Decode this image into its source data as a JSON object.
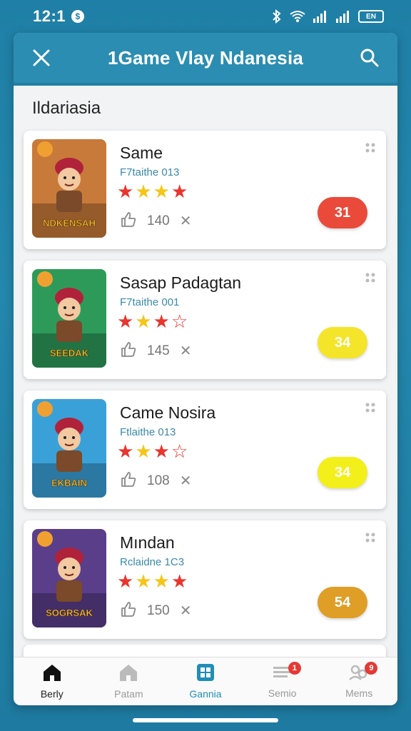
{
  "status_bar": {
    "time": "12:1",
    "notif_glyph": "$",
    "battery": "EN"
  },
  "header": {
    "title": "1Game Vlay Ndanesia",
    "close_icon": "close-icon",
    "search_icon": "search-icon"
  },
  "section": {
    "title": "Ildariasia"
  },
  "games": [
    {
      "name": "Same",
      "subtitle": "F7taithe 013",
      "rating": 4,
      "likes": "140",
      "badge": "31",
      "badge_color": "#e94a3a",
      "thumb_text": "NDKENSAH",
      "thumb_bg": "#c87a3a"
    },
    {
      "name": "Sasap Padagtan",
      "subtitle": "F7taithe 001",
      "rating": 3,
      "likes": "145",
      "badge": "34",
      "badge_color": "#f4e52a",
      "thumb_text": "SEEDAK",
      "thumb_bg": "#2e9a5a"
    },
    {
      "name": "Came Nosira",
      "subtitle": "Ftlaithe 013",
      "rating": 3,
      "likes": "108",
      "badge": "34",
      "badge_color": "#f3ef1a",
      "thumb_text": "EKBAIN",
      "thumb_bg": "#3aa0d8"
    },
    {
      "name": "Mından",
      "subtitle": "Rclaidne 1C3",
      "rating": 4,
      "likes": "150",
      "badge": "54",
      "badge_color": "#df9e26",
      "thumb_text": "SOGRSAK",
      "thumb_bg": "#5a3e8a"
    }
  ],
  "nav": [
    {
      "label": "Berly",
      "icon": "home-filled-icon",
      "active": true
    },
    {
      "label": "Patam",
      "icon": "home-outline-icon",
      "active": false
    },
    {
      "label": "Gannia",
      "icon": "grid-icon",
      "active": false
    },
    {
      "label": "Semio",
      "icon": "news-icon",
      "active": false,
      "badge": "1"
    },
    {
      "label": "Mems",
      "icon": "people-icon",
      "active": false,
      "badge": "9"
    }
  ],
  "colors": {
    "primary": "#2b8db2",
    "star_red": "#e8352e",
    "star_yellow": "#f5c518"
  }
}
